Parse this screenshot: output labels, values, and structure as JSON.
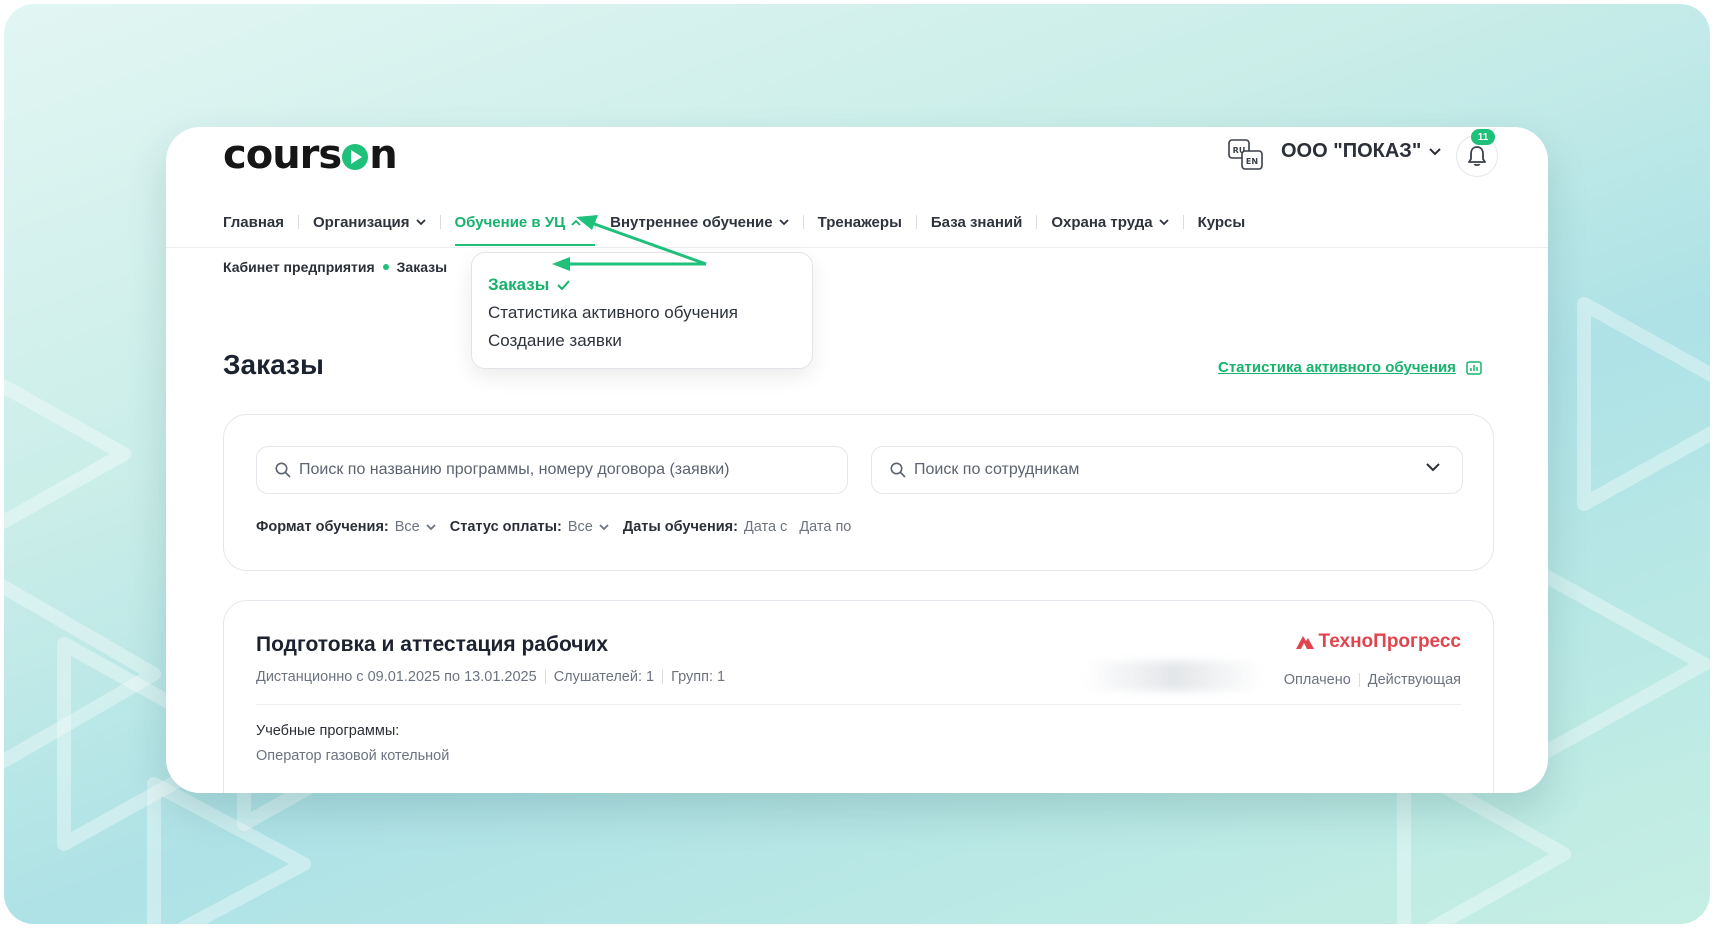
{
  "header": {
    "logo_before": "cours",
    "logo_after": "n",
    "lang_primary": "RU",
    "lang_secondary": "EN",
    "org_name": "ООО \"ПОКАЗ\"",
    "notifications_count": "11"
  },
  "nav": {
    "items": [
      {
        "label": "Главная"
      },
      {
        "label": "Организация"
      },
      {
        "label": "Обучение в УЦ"
      },
      {
        "label": "Внутреннее обучение"
      },
      {
        "label": "Тренажеры"
      },
      {
        "label": "База знаний"
      },
      {
        "label": "Охрана труда"
      },
      {
        "label": "Курсы"
      }
    ]
  },
  "breadcrumb": {
    "parent": "Кабинет предприятия",
    "current": "Заказы"
  },
  "dropdown": {
    "items": [
      {
        "label": "Заказы"
      },
      {
        "label": "Статистика активного обучения"
      },
      {
        "label": "Создание заявки"
      }
    ]
  },
  "page": {
    "title": "Заказы",
    "stats_link": "Статистика активного обучения"
  },
  "filters": {
    "search_program_placeholder": "Поиск по названию программы, номеру договора (заявки)",
    "search_employee_placeholder": "Поиск по сотрудникам",
    "format_label": "Формат обучения:",
    "format_value": "Все",
    "payment_label": "Статус оплаты:",
    "payment_value": "Все",
    "dates_label": "Даты обучения:",
    "date_from": "Дата с",
    "date_to": "Дата по"
  },
  "order": {
    "title": "Подготовка и аттестация рабочих",
    "schedule": "Дистанционно с 09.01.2025 по 13.01.2025",
    "listeners": "Слушателей: 1",
    "groups": "Групп: 1",
    "provider": "ТехноПрогресс",
    "payment_status": "Оплачено",
    "state": "Действующая",
    "programs_label": "Учебные программы:",
    "program": "Оператор газовой котельной"
  },
  "colors": {
    "accent": "#1ec07a",
    "provider": "#e0454e",
    "text": "#1d2230"
  }
}
